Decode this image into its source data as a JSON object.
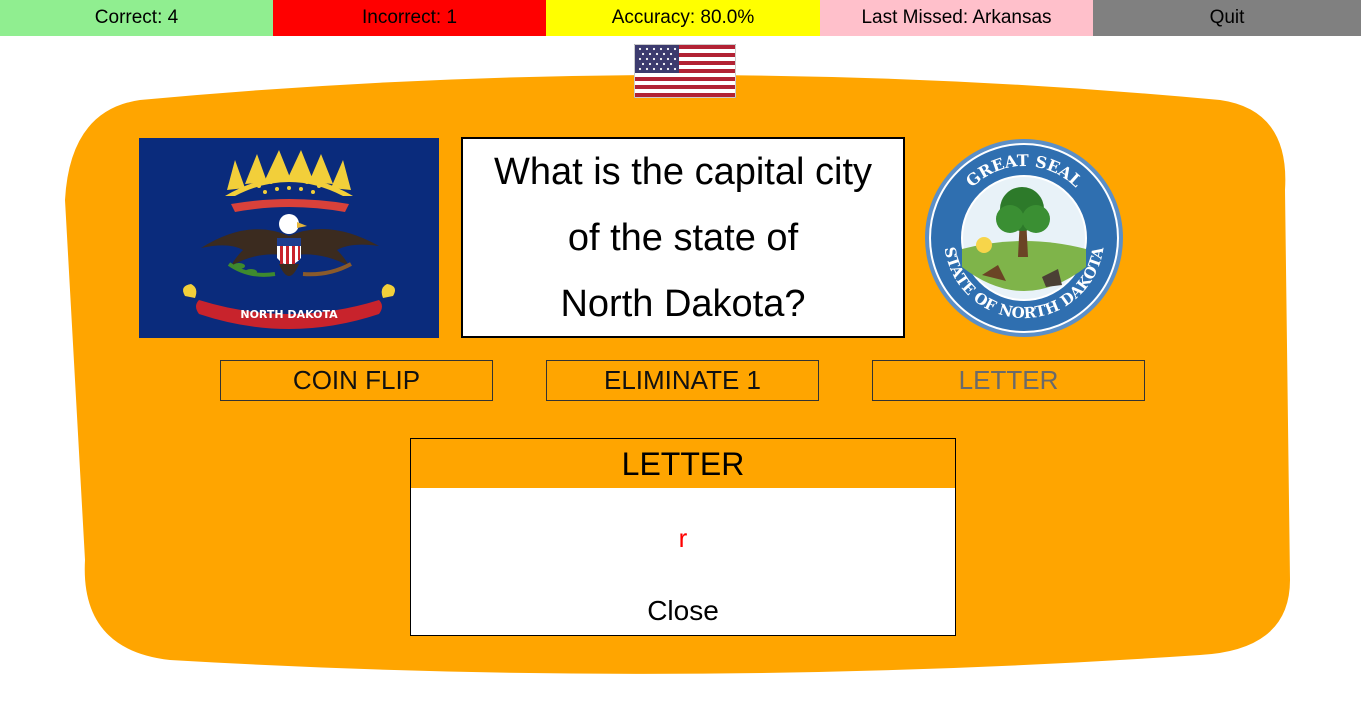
{
  "stats": {
    "correct": "Correct: 4",
    "incorrect": "Incorrect: 1",
    "accuracy": "Accuracy: 80.0%",
    "last_missed": "Last Missed: Arkansas",
    "quit": "Quit"
  },
  "colors": {
    "correct": "#90ee90",
    "incorrect": "#ff0000",
    "accuracy": "#ffff00",
    "last_missed": "#ffc0cb",
    "quit": "#808080",
    "panel": "#ffa500",
    "hint_letter": "#ff0000"
  },
  "question": {
    "text": "What is the capital city of the state of North Dakota?",
    "lines": [
      "What is the capital city",
      "of the state of",
      "North Dakota?"
    ]
  },
  "images": {
    "header_flag": "us-flag",
    "state_flag": "north-dakota-flag",
    "state_flag_text": "NORTH DAKOTA",
    "state_seal": "north-dakota-seal",
    "seal_text_top": "GREAT SEAL",
    "seal_text_bottom": "STATE OF NORTH DAKOTA"
  },
  "hints": {
    "coin_flip": "COIN FLIP",
    "eliminate": "ELIMINATE 1",
    "letter": "LETTER"
  },
  "modal": {
    "title": "LETTER",
    "letter": "r",
    "close": "Close"
  }
}
